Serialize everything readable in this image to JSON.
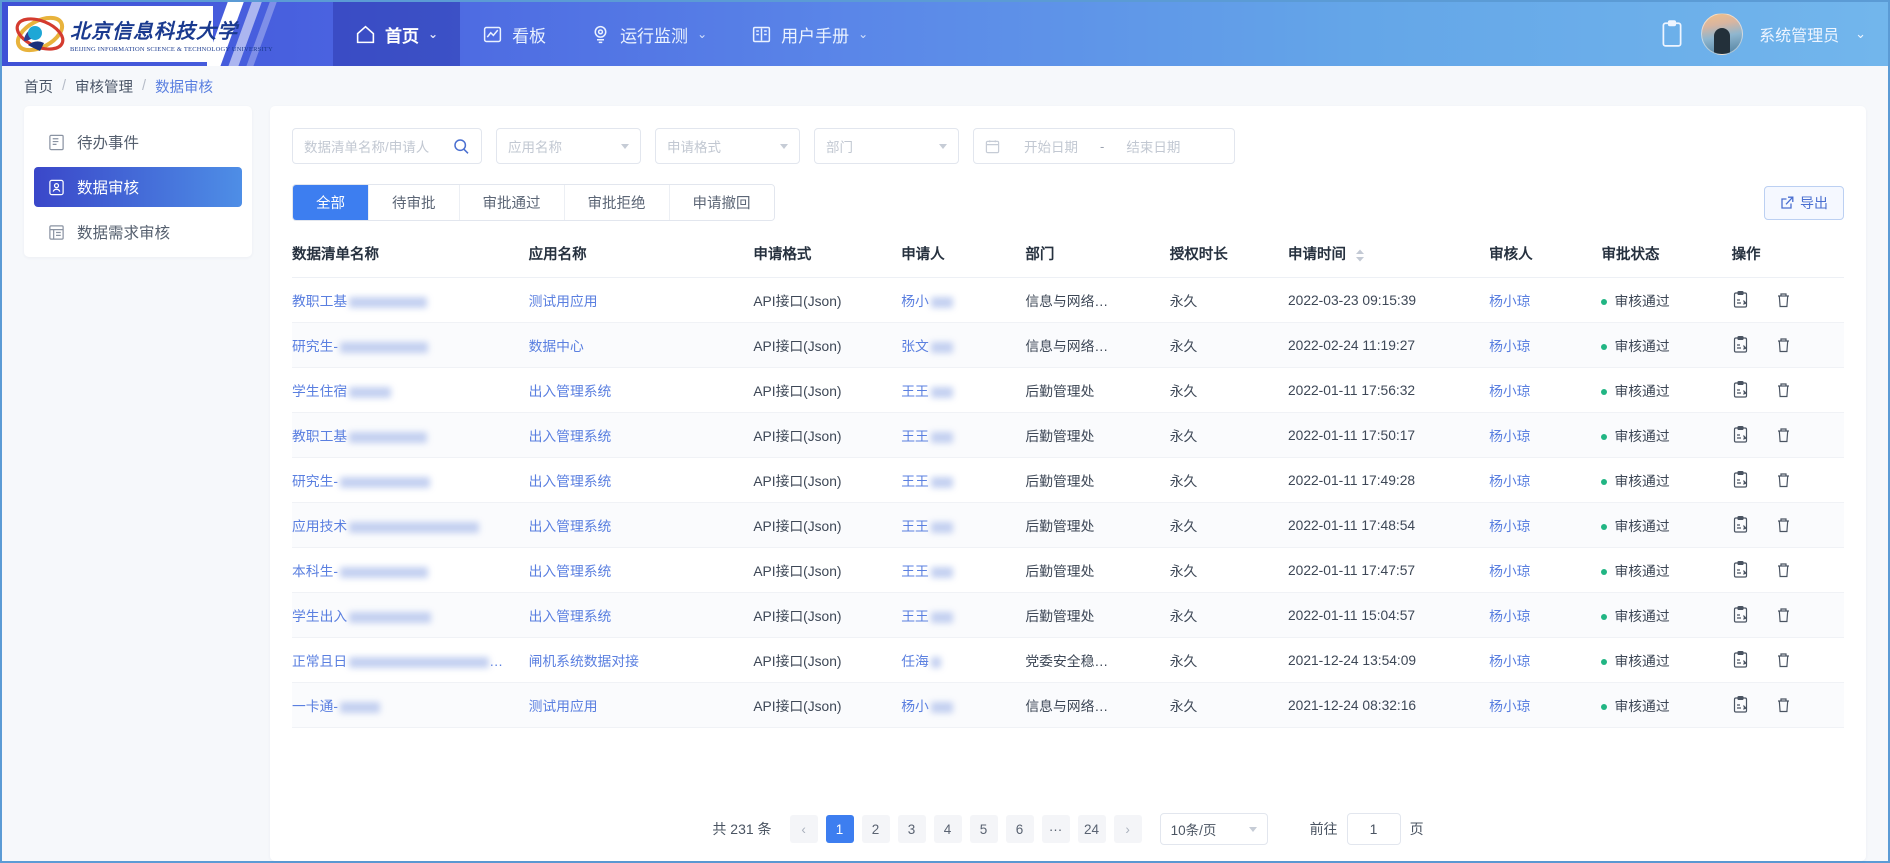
{
  "header": {
    "logo_cn": "北京信息科技大学",
    "logo_en": "BEIJING INFORMATION SCIENCE & TECHNOLOGY UNIVERSITY",
    "nav": [
      {
        "label": "首页",
        "icon": "home-icon",
        "caret": "⌄",
        "active": true
      },
      {
        "label": "看板",
        "icon": "dashboard-icon",
        "caret": "",
        "active": false
      },
      {
        "label": "运行监测",
        "icon": "monitor-icon",
        "caret": "⌄",
        "active": false
      },
      {
        "label": "用户手册",
        "icon": "book-icon",
        "caret": "⌄",
        "active": false
      }
    ],
    "user_name": "系统管理员",
    "user_caret": "⌄"
  },
  "breadcrumb": {
    "items": [
      "首页",
      "审核管理",
      "数据审核"
    ],
    "separator": "/"
  },
  "sidebar": {
    "items": [
      {
        "label": "待办事件",
        "icon": "pending-events-icon",
        "active": false
      },
      {
        "label": "数据审核",
        "icon": "data-audit-icon",
        "active": true
      },
      {
        "label": "数据需求审核",
        "icon": "data-requirement-icon",
        "active": false
      }
    ]
  },
  "filters": {
    "search_placeholder": "数据清单名称/申请人",
    "app_name_placeholder": "应用名称",
    "format_placeholder": "申请格式",
    "department_placeholder": "部门",
    "start_date_placeholder": "开始日期",
    "date_separator": "-",
    "end_date_placeholder": "结束日期"
  },
  "tabs": [
    {
      "label": "全部",
      "active": true
    },
    {
      "label": "待审批",
      "active": false
    },
    {
      "label": "审批通过",
      "active": false
    },
    {
      "label": "审批拒绝",
      "active": false
    },
    {
      "label": "申请撤回",
      "active": false
    }
  ],
  "export_button": "导出",
  "table": {
    "columns": [
      "数据清单名称",
      "应用名称",
      "申请格式",
      "申请人",
      "部门",
      "授权时长",
      "申请时间",
      "审核人",
      "审批状态",
      "操作"
    ],
    "sortable_column": "申请时间",
    "rows": [
      {
        "name": "教职工基",
        "name_redact": 78,
        "app": "测试用应用",
        "format": "API接口(Json)",
        "applicant": "杨小",
        "applicant_redact": 22,
        "dept": "信息与网络…",
        "duration": "永久",
        "time": "2022-03-23 09:15:39",
        "auditor": "杨小琼",
        "status": "审核通过"
      },
      {
        "name": "研究生-",
        "name_redact": 88,
        "app": "数据中心",
        "format": "API接口(Json)",
        "applicant": "张文",
        "applicant_redact": 22,
        "dept": "信息与网络…",
        "duration": "永久",
        "time": "2022-02-24 11:19:27",
        "auditor": "杨小琼",
        "status": "审核通过"
      },
      {
        "name": "学生住宿",
        "name_redact": 42,
        "app": "出入管理系统",
        "format": "API接口(Json)",
        "applicant": "王王",
        "applicant_redact": 22,
        "dept": "后勤管理处",
        "duration": "永久",
        "time": "2022-01-11 17:56:32",
        "auditor": "杨小琼",
        "status": "审核通过"
      },
      {
        "name": "教职工基",
        "name_redact": 78,
        "app": "出入管理系统",
        "format": "API接口(Json)",
        "applicant": "王王",
        "applicant_redact": 22,
        "dept": "后勤管理处",
        "duration": "永久",
        "time": "2022-01-11 17:50:17",
        "auditor": "杨小琼",
        "status": "审核通过"
      },
      {
        "name": "研究生-",
        "name_redact": 90,
        "app": "出入管理系统",
        "format": "API接口(Json)",
        "applicant": "王王",
        "applicant_redact": 22,
        "dept": "后勤管理处",
        "duration": "永久",
        "time": "2022-01-11 17:49:28",
        "auditor": "杨小琼",
        "status": "审核通过"
      },
      {
        "name": "应用技术",
        "name_redact": 130,
        "app": "出入管理系统",
        "format": "API接口(Json)",
        "applicant": "王王",
        "applicant_redact": 22,
        "dept": "后勤管理处",
        "duration": "永久",
        "time": "2022-01-11 17:48:54",
        "auditor": "杨小琼",
        "status": "审核通过"
      },
      {
        "name": "本科生-",
        "name_redact": 88,
        "app": "出入管理系统",
        "format": "API接口(Json)",
        "applicant": "王王",
        "applicant_redact": 22,
        "dept": "后勤管理处",
        "duration": "永久",
        "time": "2022-01-11 17:47:57",
        "auditor": "杨小琼",
        "status": "审核通过"
      },
      {
        "name": "学生出入",
        "name_redact": 82,
        "app": "出入管理系统",
        "format": "API接口(Json)",
        "applicant": "王王",
        "applicant_redact": 22,
        "dept": "后勤管理处",
        "duration": "永久",
        "time": "2022-01-11 15:04:57",
        "auditor": "杨小琼",
        "status": "审核通过"
      },
      {
        "name": "正常且日",
        "name_redact": 140,
        "name_suffix": "…",
        "app": "闸机系统数据对接",
        "format": "API接口(Json)",
        "applicant": "任海",
        "applicant_redact": 10,
        "dept": "党委安全稳…",
        "duration": "永久",
        "time": "2021-12-24 13:54:09",
        "auditor": "杨小琼",
        "status": "审核通过"
      },
      {
        "name": "一卡通-",
        "name_redact": 40,
        "app": "测试用应用",
        "format": "API接口(Json)",
        "applicant": "杨小",
        "applicant_redact": 22,
        "dept": "信息与网络…",
        "duration": "永久",
        "time": "2021-12-24 08:32:16",
        "auditor": "杨小琼",
        "status": "审核通过"
      }
    ]
  },
  "pagination": {
    "total_text": "共 231 条",
    "prev": "‹",
    "pages": [
      "1",
      "2",
      "3",
      "4",
      "5",
      "6",
      "···",
      "24"
    ],
    "current": "1",
    "next": "›",
    "page_size": "10条/页",
    "goto_label": "前往",
    "goto_value": "1",
    "goto_unit": "页"
  }
}
